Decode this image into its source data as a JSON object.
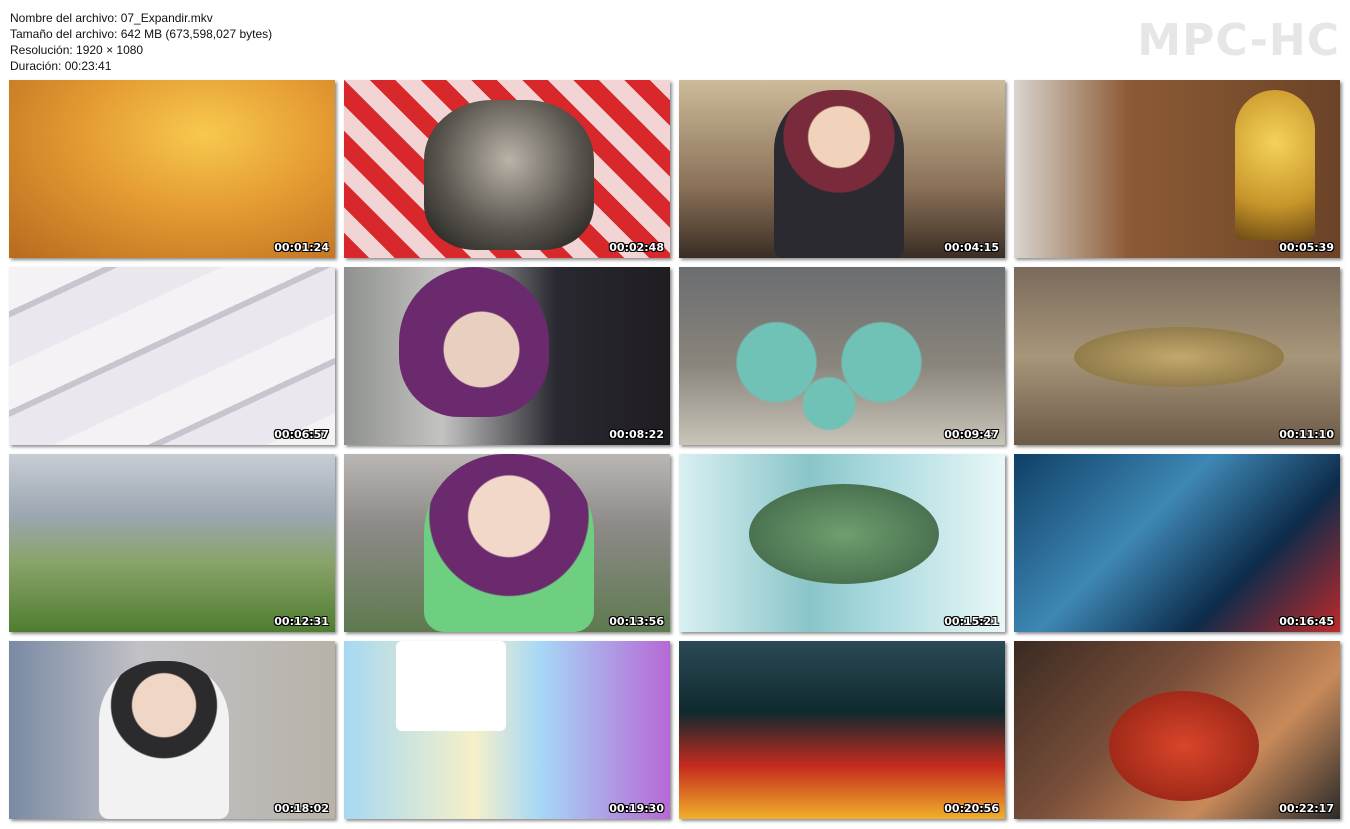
{
  "header": {
    "file_name": "Nombre del archivo: 07_Expandir.mkv",
    "file_size": "Tamaño del archivo: 642 MB (673,598,027 bytes)",
    "resolution": "Resolución: 1920 × 1080",
    "duration": "Duración: 00:23:41"
  },
  "watermark": "MPC-HC",
  "thumbnails": [
    {
      "timestamp": "00:01:24"
    },
    {
      "timestamp": "00:02:48"
    },
    {
      "timestamp": "00:04:15"
    },
    {
      "timestamp": "00:05:39"
    },
    {
      "timestamp": "00:06:57"
    },
    {
      "timestamp": "00:08:22"
    },
    {
      "timestamp": "00:09:47"
    },
    {
      "timestamp": "00:11:10"
    },
    {
      "timestamp": "00:12:31"
    },
    {
      "timestamp": "00:13:56"
    },
    {
      "timestamp": "00:15:21"
    },
    {
      "timestamp": "00:16:45"
    },
    {
      "timestamp": "00:18:02"
    },
    {
      "timestamp": "00:19:30"
    },
    {
      "timestamp": "00:20:56"
    },
    {
      "timestamp": "00:22:17"
    }
  ]
}
